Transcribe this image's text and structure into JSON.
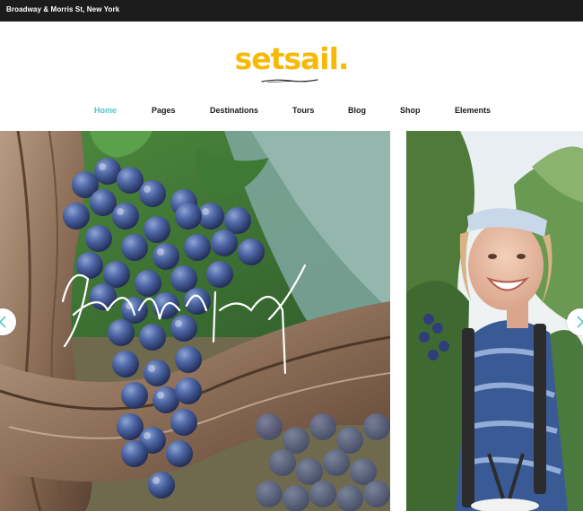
{
  "topbar": {
    "address": "Broadway & Morris St, New York"
  },
  "brand": {
    "name": "setsail.",
    "color": "#f7b903"
  },
  "nav": {
    "items": [
      {
        "label": "Home",
        "active": true
      },
      {
        "label": "Pages"
      },
      {
        "label": "Destinations"
      },
      {
        "label": "Tours"
      },
      {
        "label": "Blog"
      },
      {
        "label": "Shop"
      },
      {
        "label": "Elements"
      }
    ],
    "active_color": "#4fc7c3"
  },
  "slider": {
    "slides": [
      {
        "subject": "grapes on vine with handwritten signature"
      },
      {
        "subject": "smiling woman picking blueberries"
      }
    ],
    "controls": {
      "prev_icon": "chevron-left-icon",
      "next_icon": "chevron-right-icon"
    }
  }
}
